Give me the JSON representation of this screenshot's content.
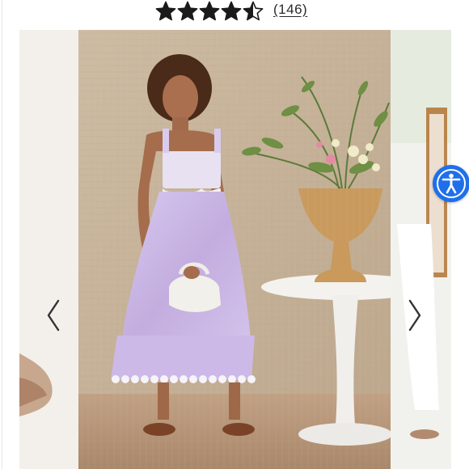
{
  "rating": {
    "stars_value": 4.5,
    "stars_max": 5,
    "review_count": "(146)"
  },
  "carousel": {
    "prev_icon": "chevron-left-icon",
    "next_icon": "chevron-right-icon"
  },
  "accessibility": {
    "icon": "accessibility-person-icon",
    "color": "#1f6feb"
  },
  "colors": {
    "star": "#1a1a1a",
    "dress": "#c9b6e6",
    "backdrop": "#c8b69e",
    "floor": "#b89a7c"
  }
}
